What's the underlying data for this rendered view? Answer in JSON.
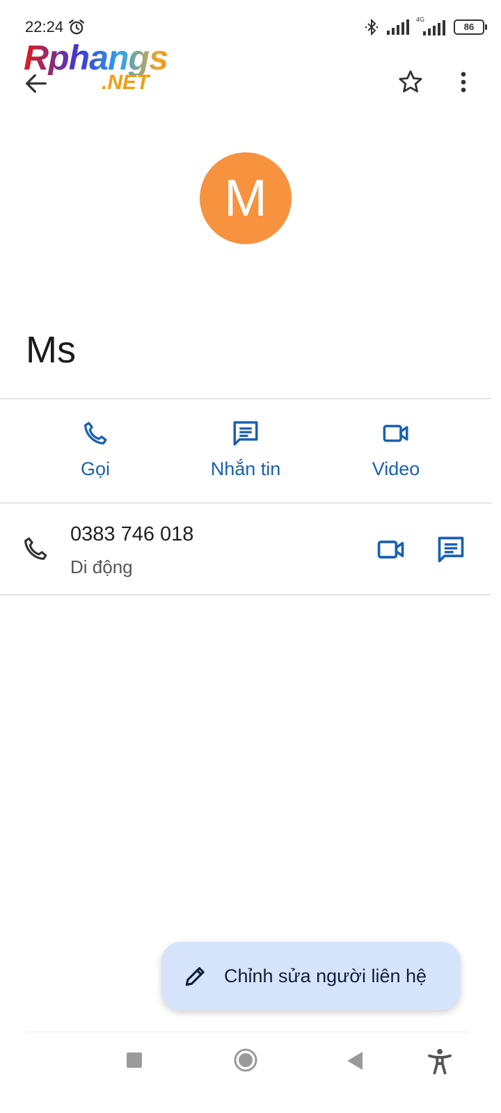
{
  "status_bar": {
    "time": "22:24",
    "network": "4G",
    "battery": "86"
  },
  "watermark": {
    "logo_main": "Rphangs",
    "logo_sub": ".NET"
  },
  "contact": {
    "initial": "M",
    "name": "Ms",
    "avatar_color": "#f7923f"
  },
  "actions": [
    {
      "label": "Gọi"
    },
    {
      "label": "Nhắn tin"
    },
    {
      "label": "Video"
    }
  ],
  "phone_entry": {
    "number": "0383 746 018",
    "type": "Di động"
  },
  "fab": {
    "label": "Chỉnh sửa người liên hệ"
  },
  "colors": {
    "accent": "#1a5fb4",
    "fab_bg": "#d6e4fb"
  }
}
